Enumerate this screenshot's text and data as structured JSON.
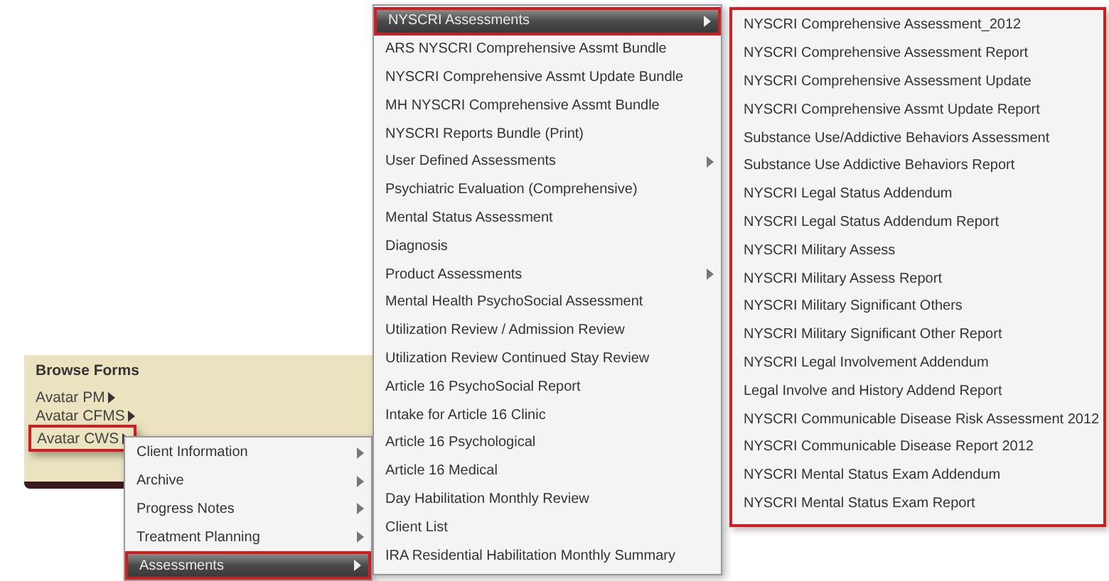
{
  "browse_forms": {
    "title": "Browse Forms",
    "items": [
      {
        "label": "Avatar PM",
        "selected": false
      },
      {
        "label": "Avatar CFMS",
        "selected": false
      },
      {
        "label": "Avatar CWS",
        "selected": true
      }
    ]
  },
  "menus": [
    {
      "outlined": false,
      "items": [
        {
          "label": "Client Information",
          "has_submenu": true,
          "selected": false
        },
        {
          "label": "Archive",
          "has_submenu": true,
          "selected": false
        },
        {
          "label": "Progress Notes",
          "has_submenu": true,
          "selected": false
        },
        {
          "label": "Treatment Planning",
          "has_submenu": true,
          "selected": false
        },
        {
          "label": "Assessments",
          "has_submenu": true,
          "selected": true
        }
      ]
    },
    {
      "outlined": false,
      "items": [
        {
          "label": "NYSCRI Assessments",
          "has_submenu": true,
          "selected": true
        },
        {
          "label": "ARS NYSCRI Comprehensive Assmt Bundle",
          "has_submenu": false,
          "selected": false
        },
        {
          "label": "NYSCRI Comprehensive Assmt Update Bundle",
          "has_submenu": false,
          "selected": false
        },
        {
          "label": "MH NYSCRI Comprehensive Assmt Bundle",
          "has_submenu": false,
          "selected": false
        },
        {
          "label": "NYSCRI Reports Bundle (Print)",
          "has_submenu": false,
          "selected": false
        },
        {
          "label": "User Defined Assessments",
          "has_submenu": true,
          "selected": false
        },
        {
          "label": "Psychiatric Evaluation (Comprehensive)",
          "has_submenu": false,
          "selected": false
        },
        {
          "label": "Mental Status Assessment",
          "has_submenu": false,
          "selected": false
        },
        {
          "label": "Diagnosis",
          "has_submenu": false,
          "selected": false
        },
        {
          "label": "Product Assessments",
          "has_submenu": true,
          "selected": false
        },
        {
          "label": "Mental Health PsychoSocial Assessment",
          "has_submenu": false,
          "selected": false
        },
        {
          "label": "Utilization Review / Admission Review",
          "has_submenu": false,
          "selected": false
        },
        {
          "label": "Utilization Review Continued Stay Review",
          "has_submenu": false,
          "selected": false
        },
        {
          "label": "Article 16 PsychoSocial Report",
          "has_submenu": false,
          "selected": false
        },
        {
          "label": "Intake for Article 16 Clinic",
          "has_submenu": false,
          "selected": false
        },
        {
          "label": "Article 16 Psychological",
          "has_submenu": false,
          "selected": false
        },
        {
          "label": "Article 16 Medical",
          "has_submenu": false,
          "selected": false
        },
        {
          "label": "Day Habilitation Monthly Review",
          "has_submenu": false,
          "selected": false
        },
        {
          "label": "Client List",
          "has_submenu": false,
          "selected": false
        },
        {
          "label": "IRA Residential Habilitation Monthly Summary",
          "has_submenu": false,
          "selected": false
        }
      ]
    },
    {
      "outlined": true,
      "items": [
        {
          "label": "NYSCRI Comprehensive Assessment_2012",
          "selected": false
        },
        {
          "label": "NYSCRI Comprehensive Assessment Report",
          "selected": false
        },
        {
          "label": "NYSCRI Comprehensive Assessment Update",
          "selected": false
        },
        {
          "label": "NYSCRI Comprehensive Assmt Update Report",
          "selected": false
        },
        {
          "label": "Substance Use/Addictive Behaviors Assessment",
          "selected": false
        },
        {
          "label": "Substance Use Addictive Behaviors Report",
          "selected": false
        },
        {
          "label": "NYSCRI Legal Status Addendum",
          "selected": false
        },
        {
          "label": "NYSCRI Legal Status Addendum Report",
          "selected": false
        },
        {
          "label": "NYSCRI Military Assess",
          "selected": false
        },
        {
          "label": "NYSCRI Military Assess Report",
          "selected": false
        },
        {
          "label": "NYSCRI Military Significant Others",
          "selected": false
        },
        {
          "label": "NYSCRI Military Significant Other Report",
          "selected": false
        },
        {
          "label": "NYSCRI Legal Involvement Addendum",
          "selected": false
        },
        {
          "label": "Legal Involve and History Addend Report",
          "selected": false
        },
        {
          "label": "NYSCRI Communicable Disease Risk Assessment 2012",
          "selected": false
        },
        {
          "label": "NYSCRI Communicable Disease Report 2012",
          "selected": false
        },
        {
          "label": "NYSCRI Mental Status Exam Addendum",
          "selected": false
        },
        {
          "label": "NYSCRI Mental Status Exam Report",
          "selected": false
        }
      ]
    }
  ]
}
